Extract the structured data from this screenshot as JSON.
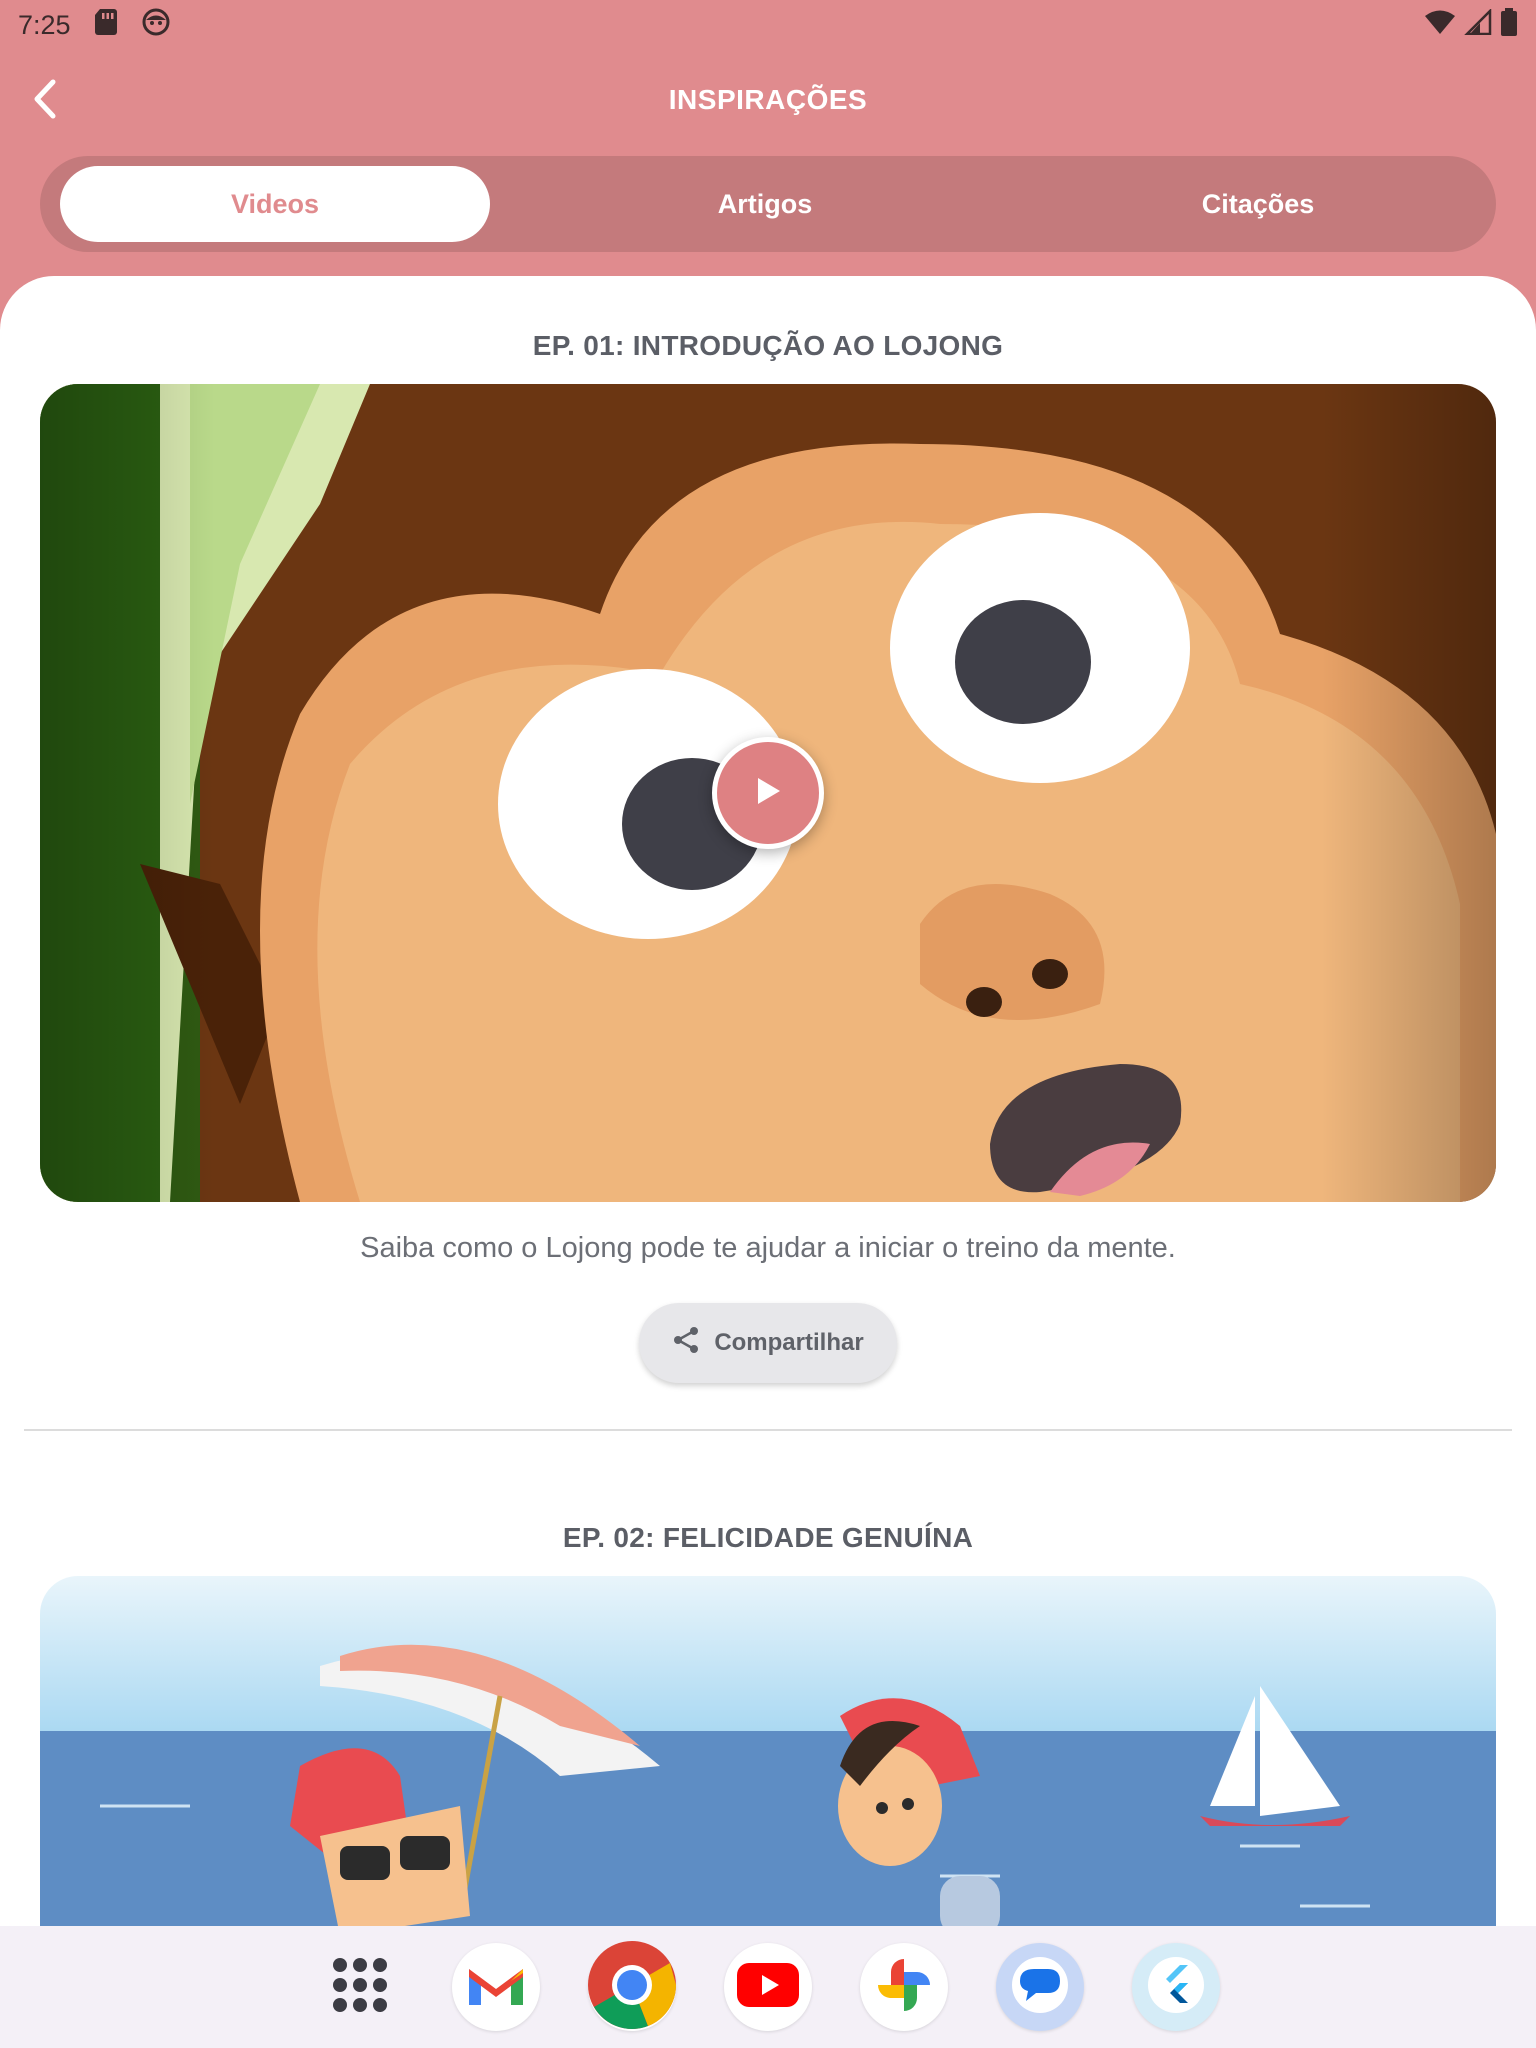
{
  "status_bar": {
    "time": "7:25",
    "left_icons": [
      "sd-card-icon",
      "face-icon"
    ],
    "right_icons": [
      "wifi-icon",
      "signal-icon",
      "battery-icon"
    ]
  },
  "header": {
    "title": "INSPIRAÇÕES",
    "back_icon": "chevron-left-icon"
  },
  "tabs": [
    {
      "label": "Videos",
      "active": true
    },
    {
      "label": "Artigos",
      "active": false
    },
    {
      "label": "Citações",
      "active": false
    }
  ],
  "episodes": [
    {
      "title": "EP. 01: INTRODUÇÃO AO LOJONG",
      "description": "Saiba como o Lojong pode te ajudar a iniciar o treino da mente.",
      "share_label": "Compartilhar"
    },
    {
      "title": "EP. 02: FELICIDADE GENUÍNA"
    }
  ],
  "dock": {
    "apps": [
      "app-grid-icon",
      "gmail-icon",
      "chrome-icon",
      "youtube-icon",
      "photos-icon",
      "messages-icon",
      "flutter-icon"
    ]
  },
  "colors": {
    "accent": "#e08b8e",
    "tab_track": "#c47a7c",
    "play": "#de8183"
  }
}
